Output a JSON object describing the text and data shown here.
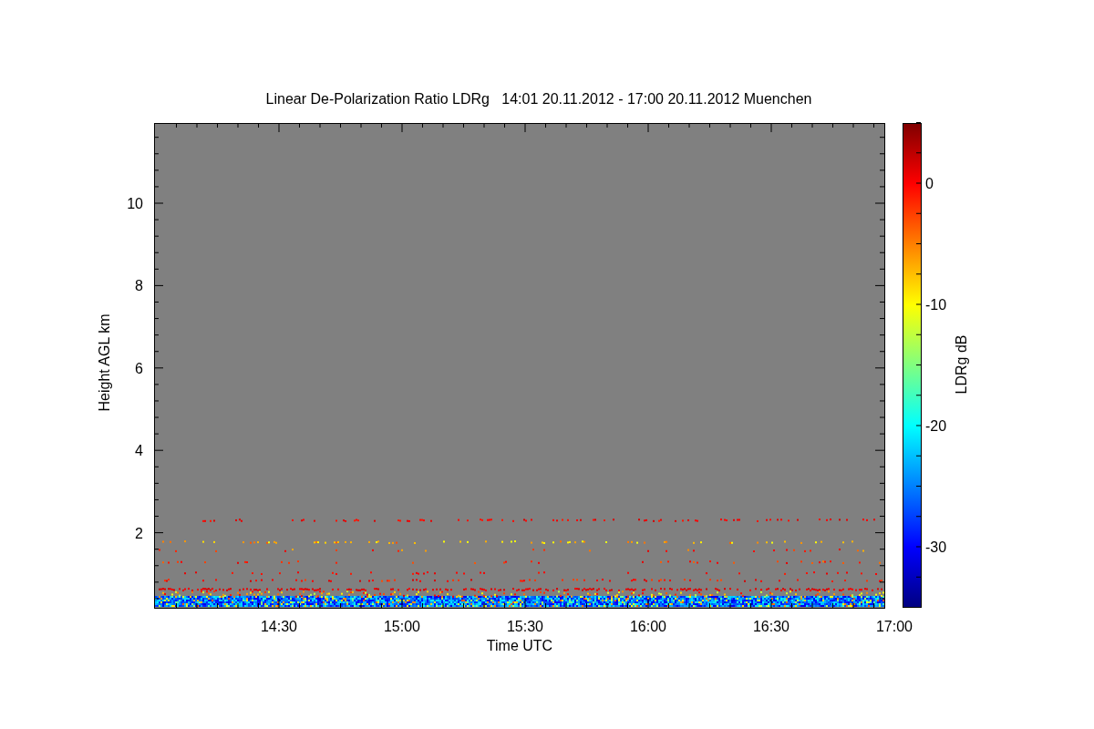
{
  "title": "Linear De-Polarization Ratio LDRg   14:01 20.11.2012 - 17:00 20.11.2012 Muenchen",
  "y_axis": {
    "label": "Height AGL km",
    "ticks": [
      "10",
      "8",
      "6",
      "4",
      "2"
    ]
  },
  "x_axis": {
    "label": "Time UTC",
    "ticks": [
      "14:30",
      "15:00",
      "15:30",
      "16:00",
      "16:30",
      "17:00"
    ]
  },
  "colorbar": {
    "label": "LDRg dB",
    "ticks": [
      "0",
      "-10",
      "-20",
      "-30"
    ]
  }
}
